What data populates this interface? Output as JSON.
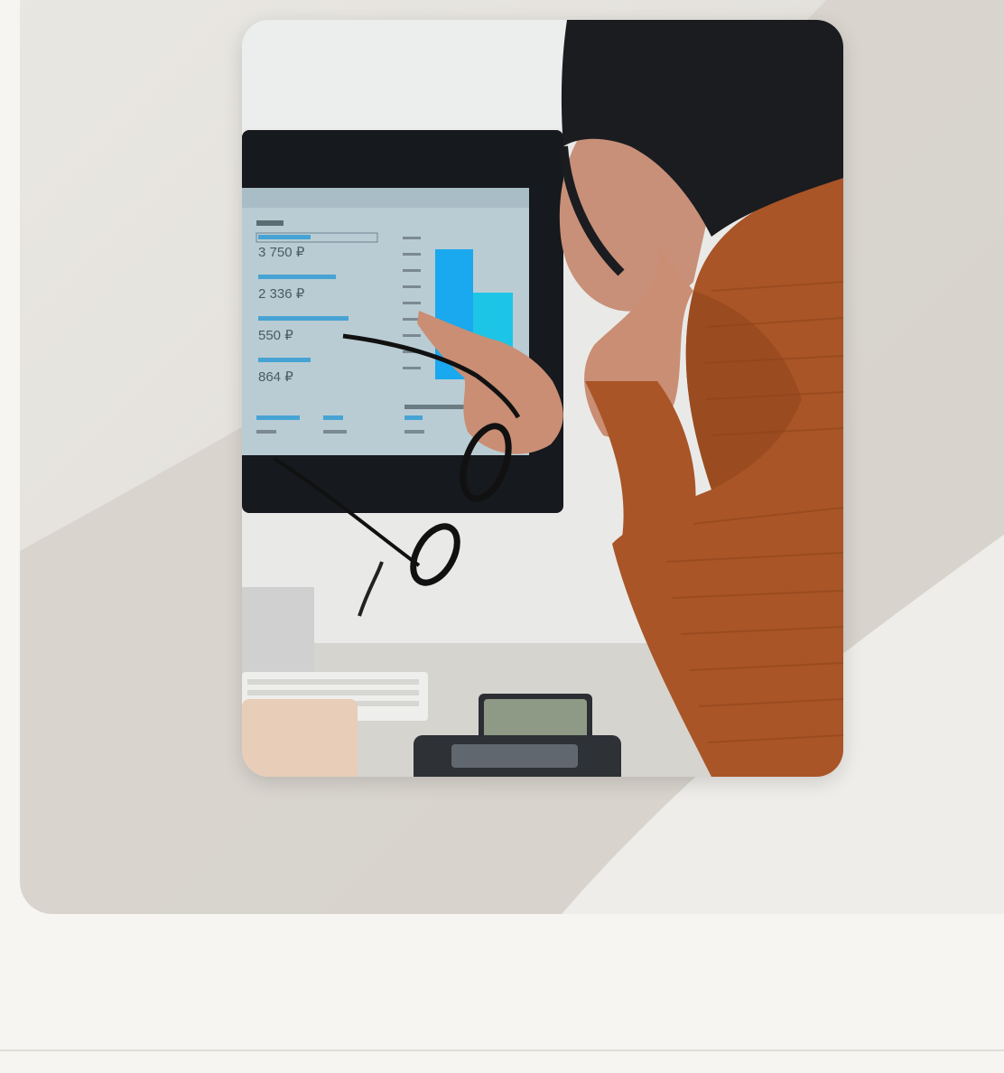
{
  "hero_photo": {
    "monitor_stats": [
      {
        "value": "3 750 ₽"
      },
      {
        "value": "2 336 ₽"
      },
      {
        "value": "550 ₽"
      },
      {
        "value": "864 ₽"
      }
    ],
    "bar_colors": [
      "#1aa8ee",
      "#1cc5e6"
    ]
  },
  "colors": {
    "page_background": "#f6f5f1",
    "card_background": "#e6e4df",
    "sweater": "#a95527",
    "hair": "#1a1c20"
  }
}
